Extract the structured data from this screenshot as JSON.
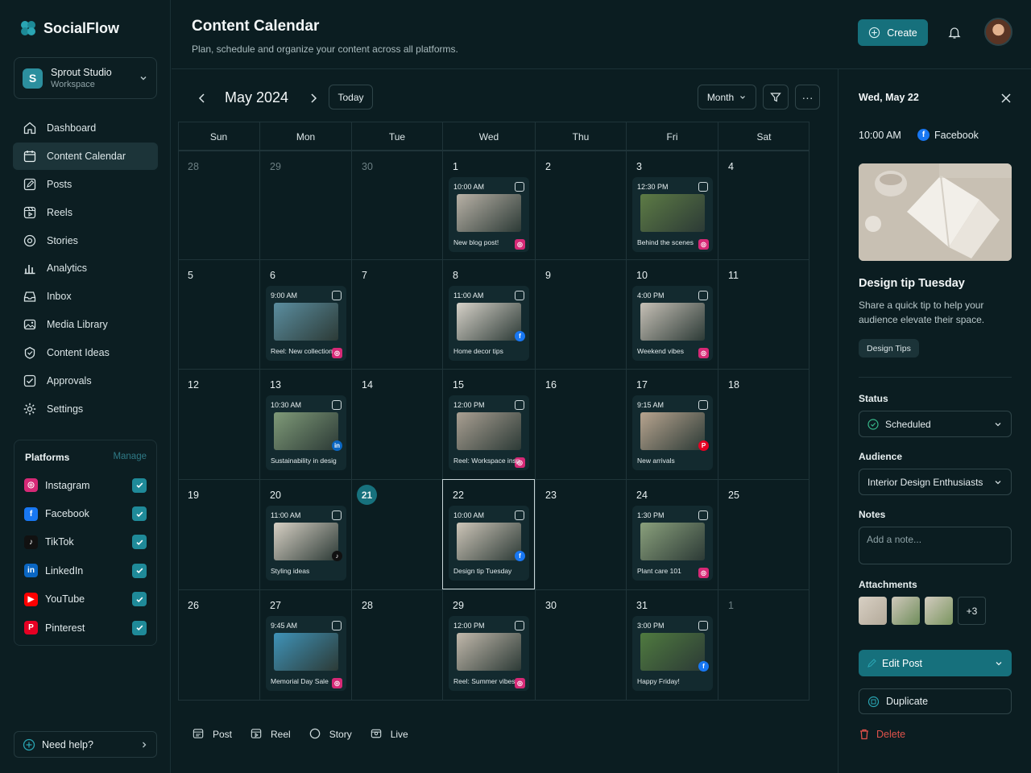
{
  "brand": {
    "name": "SocialFlow"
  },
  "workspace": {
    "initial": "S",
    "name": "Sprout Studio",
    "subtitle": "Workspace"
  },
  "nav": [
    {
      "label": "Dashboard",
      "icon": "home-icon",
      "active": false
    },
    {
      "label": "Content Calendar",
      "icon": "calendar-icon",
      "active": true
    },
    {
      "label": "Posts",
      "icon": "edit-icon",
      "active": false
    },
    {
      "label": "Reels",
      "icon": "reels-icon",
      "active": false
    },
    {
      "label": "Stories",
      "icon": "stories-icon",
      "active": false
    },
    {
      "label": "Analytics",
      "icon": "analytics-icon",
      "active": false
    },
    {
      "label": "Inbox",
      "icon": "inbox-icon",
      "active": false
    },
    {
      "label": "Media Library",
      "icon": "media-icon",
      "active": false
    },
    {
      "label": "Content Ideas",
      "icon": "ideas-icon",
      "active": false
    },
    {
      "label": "Approvals",
      "icon": "approvals-icon",
      "active": false
    },
    {
      "label": "Settings",
      "icon": "gear-icon",
      "active": false
    }
  ],
  "platforms": {
    "title": "Platforms",
    "manage_label": "Manage",
    "items": [
      {
        "name": "Instagram",
        "color": "#d62976",
        "glyph": "◎",
        "checked": true
      },
      {
        "name": "Facebook",
        "color": "#1877f2",
        "glyph": "f",
        "checked": true
      },
      {
        "name": "TikTok",
        "color": "#111111",
        "glyph": "♪",
        "checked": true
      },
      {
        "name": "LinkedIn",
        "color": "#0a66c2",
        "glyph": "in",
        "checked": true
      },
      {
        "name": "YouTube",
        "color": "#ff0000",
        "glyph": "▶",
        "checked": true
      },
      {
        "name": "Pinterest",
        "color": "#e60023",
        "glyph": "P",
        "checked": true
      }
    ]
  },
  "help": {
    "label": "Need help?"
  },
  "header": {
    "title": "Content Calendar",
    "subtitle": "Plan, schedule and organize your content across all platforms.",
    "create_label": "Create"
  },
  "toolbar": {
    "month_label": "May 2024",
    "today_label": "Today",
    "view_label": "Month",
    "more_label": "···"
  },
  "calendar": {
    "weekdays": [
      "Sun",
      "Mon",
      "Tue",
      "Wed",
      "Thu",
      "Fri",
      "Sat"
    ],
    "today_day": "21",
    "selected_day": "22",
    "weeks": [
      [
        "28",
        "29",
        "30",
        "1",
        "2",
        "3",
        "4"
      ],
      [
        "5",
        "6",
        "7",
        "8",
        "9",
        "10",
        "11"
      ],
      [
        "12",
        "13",
        "14",
        "15",
        "16",
        "17",
        "18"
      ],
      [
        "19",
        "20",
        "21",
        "22",
        "23",
        "24",
        "25"
      ],
      [
        "26",
        "27",
        "28",
        "29",
        "30",
        "31",
        "1"
      ]
    ],
    "dim_cells": [
      "0-0",
      "0-1",
      "0-2",
      "4-6"
    ],
    "posts": [
      {
        "week": 0,
        "day": 3,
        "time": "10:00 AM",
        "label": "New blog post!",
        "platform": "Instagram",
        "thumb": "#b8b1a6"
      },
      {
        "week": 0,
        "day": 5,
        "time": "12:30 PM",
        "label": "Behind the scenes",
        "platform": "Instagram",
        "thumb": "#5d7b45"
      },
      {
        "week": 1,
        "day": 1,
        "time": "9:00 AM",
        "label": "Reel: New collection",
        "platform": "Instagram",
        "thumb": "#5b8ea0"
      },
      {
        "week": 1,
        "day": 3,
        "time": "11:00 AM",
        "label": "Home decor tips",
        "platform": "Facebook",
        "thumb": "#d6d1c8"
      },
      {
        "week": 1,
        "day": 5,
        "time": "4:00 PM",
        "label": "Weekend vibes",
        "platform": "Instagram",
        "thumb": "#c6c0b6"
      },
      {
        "week": 2,
        "day": 1,
        "time": "10:30 AM",
        "label": "Sustainability in design",
        "platform": "LinkedIn",
        "thumb": "#7f9a78"
      },
      {
        "week": 2,
        "day": 3,
        "time": "12:00 PM",
        "label": "Reel: Workspace inspo",
        "platform": "Instagram",
        "thumb": "#a99f92"
      },
      {
        "week": 2,
        "day": 5,
        "time": "9:15 AM",
        "label": "New arrivals",
        "platform": "Pinterest",
        "thumb": "#b7a48f"
      },
      {
        "week": 3,
        "day": 1,
        "time": "11:00 AM",
        "label": "Styling ideas",
        "platform": "TikTok",
        "thumb": "#d7d0c4"
      },
      {
        "week": 3,
        "day": 3,
        "time": "10:00 AM",
        "label": "Design tip Tuesday",
        "platform": "Facebook",
        "thumb": "#cdc5b8"
      },
      {
        "week": 3,
        "day": 5,
        "time": "1:30 PM",
        "label": "Plant care 101",
        "platform": "Instagram",
        "thumb": "#8aa07c"
      },
      {
        "week": 4,
        "day": 1,
        "time": "9:45 AM",
        "label": "Memorial Day Sale",
        "platform": "Instagram",
        "thumb": "#3f93b8"
      },
      {
        "week": 4,
        "day": 3,
        "time": "12:00 PM",
        "label": "Reel: Summer vibes",
        "platform": "Instagram",
        "thumb": "#c1b8ab"
      },
      {
        "week": 4,
        "day": 5,
        "time": "3:00 PM",
        "label": "Happy Friday!",
        "platform": "Facebook",
        "thumb": "#4f7a3f"
      }
    ]
  },
  "legend": [
    {
      "label": "Post",
      "icon": "post-icon"
    },
    {
      "label": "Reel",
      "icon": "reel-icon"
    },
    {
      "label": "Story",
      "icon": "story-icon"
    },
    {
      "label": "Live",
      "icon": "live-icon"
    }
  ],
  "panel": {
    "date": "Wed, May 22",
    "time": "10:00 AM",
    "platform": "Facebook",
    "title": "Design tip Tuesday",
    "description": "Share a quick tip to help your audience elevate their space.",
    "tag": "Design Tips",
    "status_label": "Status",
    "status_value": "Scheduled",
    "audience_label": "Audience",
    "audience_value": "Interior Design Enthusiasts",
    "notes_label": "Notes",
    "notes_placeholder": "Add a note...",
    "attachments_label": "Attachments",
    "attachments_more": "+3",
    "edit_label": "Edit Post",
    "duplicate_label": "Duplicate",
    "delete_label": "Delete"
  },
  "colors": {
    "accent": "#16707c",
    "background": "#0b1d21",
    "danger": "#e0524b"
  }
}
